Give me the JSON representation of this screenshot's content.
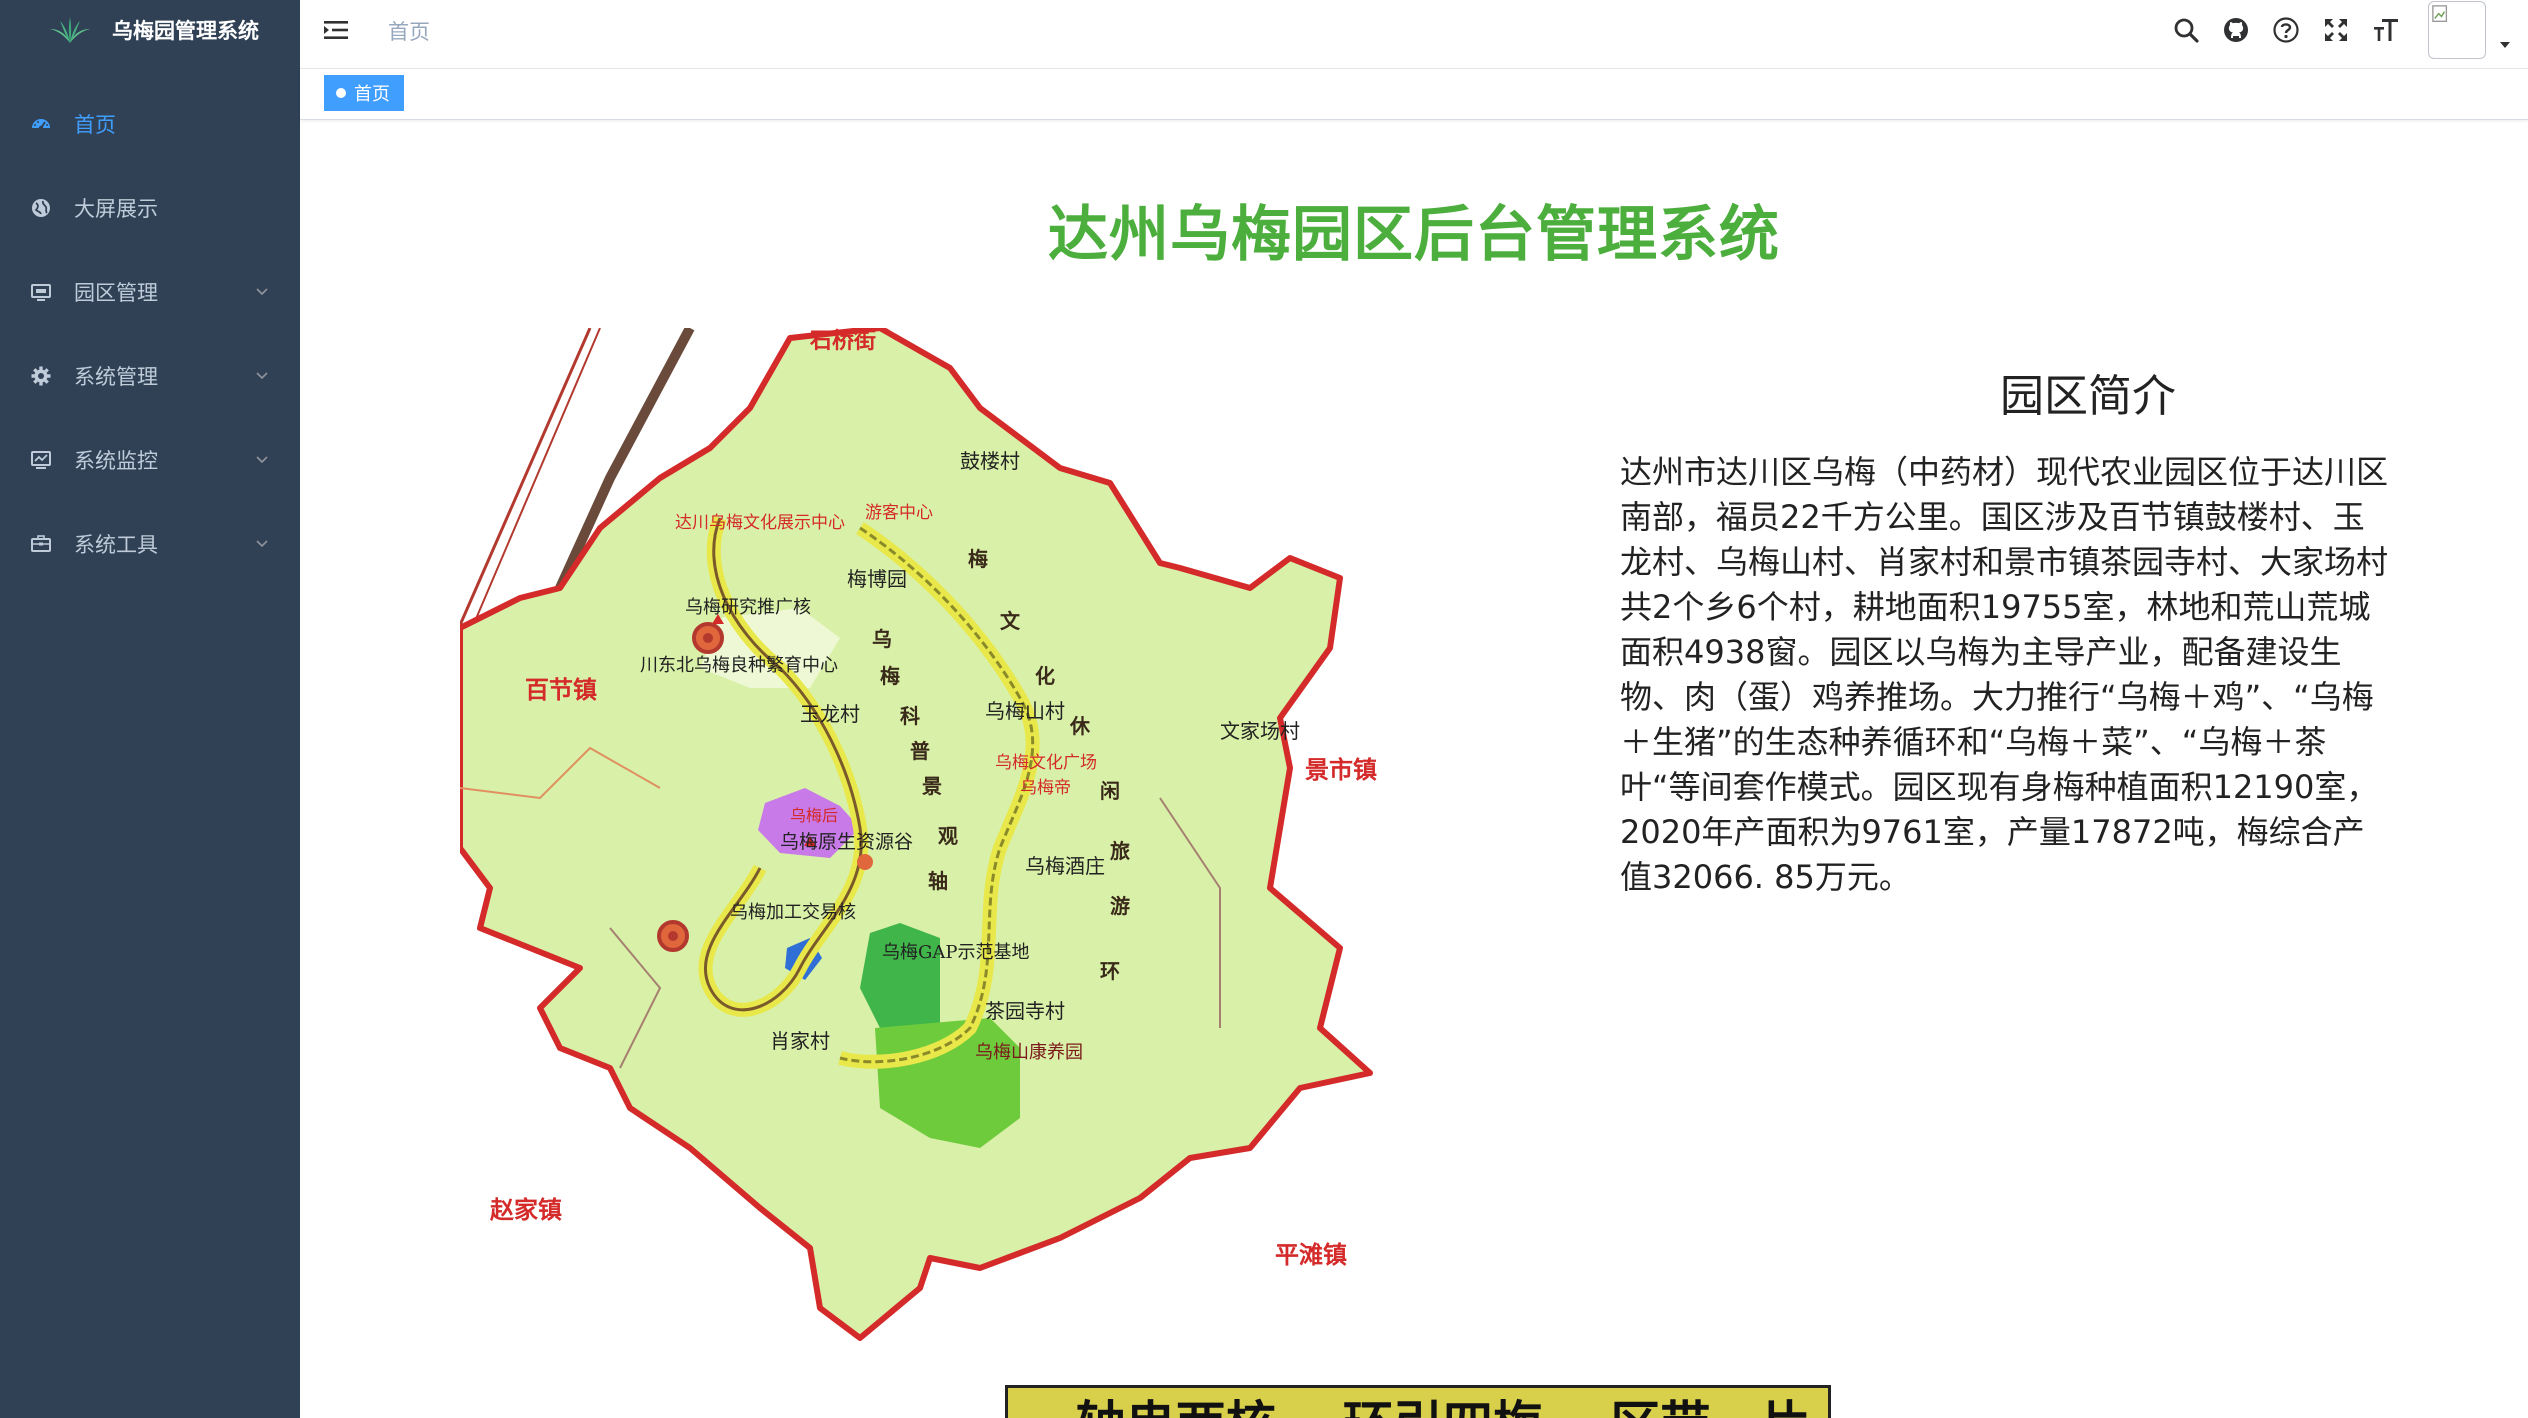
{
  "app": {
    "title": "乌梅园管理系统"
  },
  "sidebar": {
    "items": [
      {
        "label": "首页",
        "icon": "dashboard-icon",
        "active": true,
        "expandable": false
      },
      {
        "label": "大屏展示",
        "icon": "globe-icon",
        "active": false,
        "expandable": false
      },
      {
        "label": "园区管理",
        "icon": "monitor-icon",
        "active": false,
        "expandable": true
      },
      {
        "label": "系统管理",
        "icon": "gear-icon",
        "active": false,
        "expandable": true
      },
      {
        "label": "系统监控",
        "icon": "monitor-chart-icon",
        "active": false,
        "expandable": true
      },
      {
        "label": "系统工具",
        "icon": "toolbox-icon",
        "active": false,
        "expandable": true
      }
    ]
  },
  "header": {
    "breadcrumb": "首页",
    "icons": [
      "search-icon",
      "github-icon",
      "help-icon",
      "fullscreen-icon",
      "font-size-icon"
    ]
  },
  "tags": {
    "active_label": "首页"
  },
  "main": {
    "title": "达州乌梅园区后台管理系统",
    "intro_title": "园区简介",
    "intro_body": "达州市达川区乌梅（中药材）现代农业园区位于达川区南部，福员22千方公里。国区涉及百节镇鼓楼村、玉龙村、乌梅山村、肖家村和景市镇茶园寺村、大家场村共2个乡6个村，耕地面积19755室，林地和荒山荒城面积4938窗。园区以乌梅为主导产业，配备建设生物、肉（蛋）鸡养推场。大力推行“乌梅＋鸡”、“乌梅＋生猪”的生态种养循环和“乌梅＋菜”、“乌梅＋茶叶“等间套作模式。园区现有身梅种植面积12190室，2020年产面积为9761室，产量17872吨，梅综合产值32066. 85万元。",
    "slogan": "一轴串两核 一环引四梅 一区带一片",
    "map": {
      "labels": {
        "town_top": "石桥街",
        "town_left": "百节镇",
        "town_right": "景市镇",
        "town_bottom_left": "赵家镇",
        "town_bottom_right": "平滩镇",
        "gulou": "鼓楼村",
        "culture_center": "达川乌梅文化展示中心",
        "visitor": "游客中心",
        "meibo": "梅博园",
        "research": "乌梅研究推广核",
        "breeding": "川东北乌梅良种繁育中心",
        "yulong": "玉龙村",
        "wumeishan": "乌梅山村",
        "wenjiachang": "文家场村",
        "plaza": "乌梅文化广场",
        "wumeidi": "乌梅帝",
        "wumeihou": "乌梅后",
        "yuanshengtai": "乌梅原生资源谷",
        "winery": "乌梅酒庄",
        "processing": "乌梅加工交易核",
        "gap": "乌梅GAP示范基地",
        "chayuan": "茶园寺村",
        "kangyang": "乌梅山康养园",
        "xiaojia": "肖家村",
        "axis_chars": [
          "乌",
          "梅",
          "科",
          "普",
          "景",
          "观",
          "轴"
        ],
        "ring_chars": [
          "梅",
          "文",
          "化",
          "休",
          "闲",
          "旅",
          "游",
          "环"
        ]
      }
    }
  }
}
